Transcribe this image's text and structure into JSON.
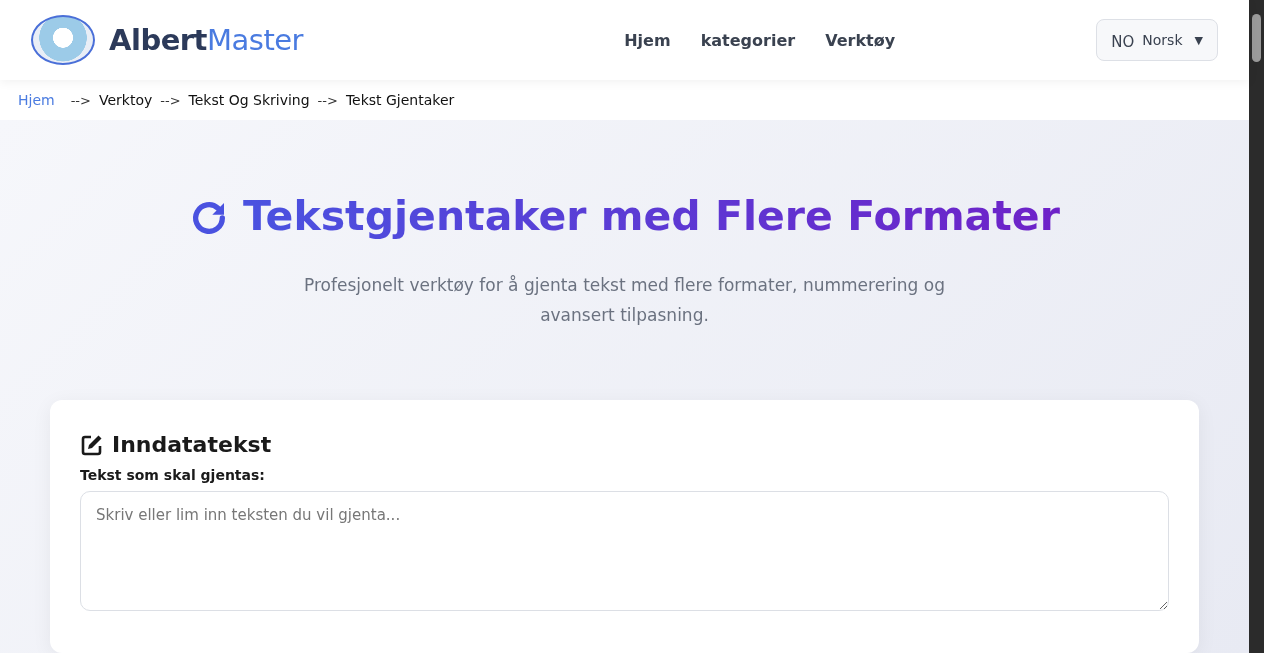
{
  "header": {
    "brand": {
      "dark": "Albert",
      "accent": "Master"
    },
    "nav": [
      {
        "label": "Hjem"
      },
      {
        "label": "kategorier"
      },
      {
        "label": "Verktøy"
      }
    ],
    "language": {
      "code": "NO",
      "label": "Norsk",
      "caret": "▼"
    }
  },
  "breadcrumb": {
    "items": [
      {
        "label": "Hjem",
        "kind": "link"
      },
      {
        "label": "Verktoy",
        "kind": "crumb"
      },
      {
        "label": "Tekst Og Skriving",
        "kind": "crumb"
      },
      {
        "label": "Tekst Gjentaker",
        "kind": "crumb"
      }
    ],
    "separator": "-->"
  },
  "hero": {
    "title": "Tekstgjentaker med Flere Formater",
    "subtitle": "Profesjonelt verktøy for å gjenta tekst med flere formater, nummerering og avansert tilpasning."
  },
  "input_card": {
    "heading": "Inndatatekst",
    "field_label": "Tekst som skal gjentas:",
    "placeholder": "Skriv eller lim inn teksten du vil gjenta..."
  }
}
